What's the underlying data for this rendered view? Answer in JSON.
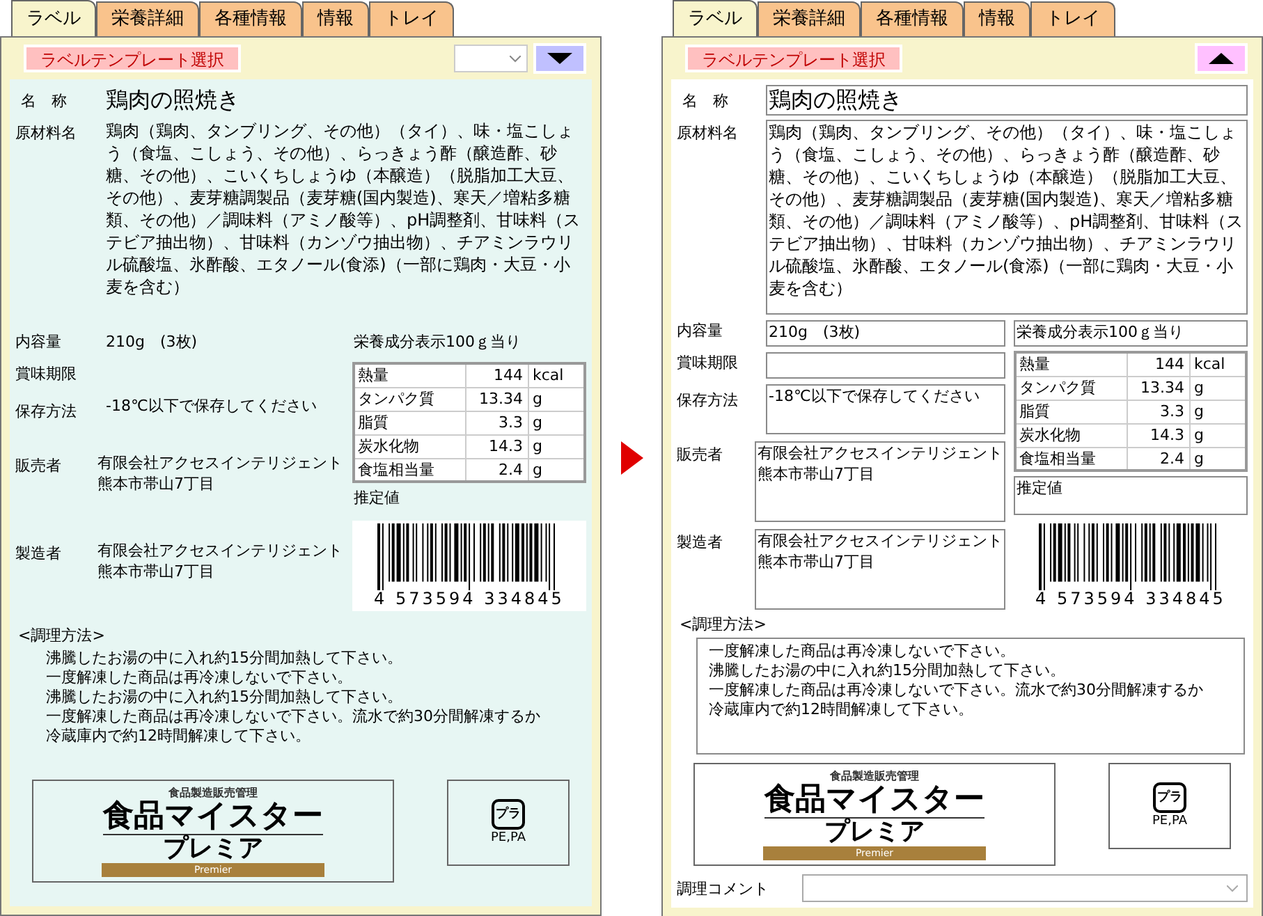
{
  "panels": [
    {
      "editable": false,
      "tabs": [
        {
          "label": "ラベル",
          "selected": true
        },
        {
          "label": "栄養詳細",
          "selected": false
        },
        {
          "label": "各種情報",
          "selected": false
        },
        {
          "label": "情報",
          "selected": false
        },
        {
          "label": "トレイ",
          "selected": false
        }
      ],
      "template_button": "ラベルテンプレート選択",
      "template_select": true,
      "expanded": false,
      "name_label": "名　称",
      "name": "鶏肉の照焼き",
      "ingredients_label": "原材料名",
      "ingredients": "鶏肉（鶏肉、タンブリング、その他）（タイ）、味・塩こしょう（食塩、こしょう、その他）、らっきょう酢（醸造酢、砂糖、その他）、こいくちしょうゆ（本醸造）（脱脂加工大豆、その他）、麦芽糖調製品（麦芽糖(国内製造)、寒天／増粘多糖類、その他）／調味料（アミノ酸等）、pH調整剤、甘味料（ステビア抽出物）、甘味料（カンゾウ抽出物）、チアミンラウリル硫酸塩、氷酢酸、エタノール(食添)（一部に鶏肉・大豆・小麦を含む）",
      "content_label": "内容量",
      "content": "210g　(3枚)",
      "best_before_label": "賞味期限",
      "storage_label": "保存方法",
      "storage": "-18℃以下で保存してください",
      "seller_label": "販売者",
      "seller": [
        "有限会社アクセスインテリジェント",
        "熊本市帯山7丁目"
      ],
      "maker_label": "製造者",
      "maker": [
        "有限会社アクセスインテリジェント",
        "熊本市帯山7丁目"
      ],
      "nutrition_title": "栄養成分表示100ｇ当り",
      "nutrition": [
        {
          "name": "熱量",
          "value": "144",
          "unit": "kcal"
        },
        {
          "name": "タンパク質",
          "value": "13.34",
          "unit": "g"
        },
        {
          "name": "脂質",
          "value": "3.3",
          "unit": "g"
        },
        {
          "name": "炭水化物",
          "value": "14.3",
          "unit": "g"
        },
        {
          "name": "食塩相当量",
          "value": "2.4",
          "unit": "g"
        }
      ],
      "nutrition_note": "推定値",
      "barcode_number": "4 573594 334845",
      "cooking_label": "<調理方法>",
      "cooking": [
        "沸騰したお湯の中に入れ約15分間加熱して下さい。",
        "一度解凍した商品は再冷凍しないで下さい。",
        "沸騰したお湯の中に入れ約15分間加熱して下さい。",
        "一度解凍した商品は再冷凍しないで下さい。流水で約30分間解凍するか",
        "冷蔵庫内で約12時間解凍して下さい。"
      ],
      "logo": {
        "caption": "食品製造販売管理",
        "title": "食品マイスター",
        "subtitle": "プレミア",
        "band": "Premier"
      },
      "recycle_label": "PE,PA",
      "recycle_mark": "プラ"
    },
    {
      "editable": true,
      "tabs": [
        {
          "label": "ラベル",
          "selected": true
        },
        {
          "label": "栄養詳細",
          "selected": false
        },
        {
          "label": "各種情報",
          "selected": false
        },
        {
          "label": "情報",
          "selected": false
        },
        {
          "label": "トレイ",
          "selected": false
        }
      ],
      "template_button": "ラベルテンプレート選択",
      "template_select": false,
      "expanded": true,
      "name_label": "名　称",
      "name": "鶏肉の照焼き",
      "ingredients_label": "原材料名",
      "ingredients": "鶏肉（鶏肉、タンブリング、その他）（タイ）、味・塩こしょう（食塩、こしょう、その他）、らっきょう酢（醸造酢、砂糖、その他）、こいくちしょうゆ（本醸造）（脱脂加工大豆、その他）、麦芽糖調製品（麦芽糖(国内製造)、寒天／増粘多糖類、その他）／調味料（アミノ酸等）、pH調整剤、甘味料（ステビア抽出物）、甘味料（カンゾウ抽出物）、チアミンラウリル硫酸塩、氷酢酸、エタノール(食添)（一部に鶏肉・大豆・小麦を含む）",
      "content_label": "内容量",
      "content": "210g　(3枚)",
      "best_before_label": "賞味期限",
      "storage_label": "保存方法",
      "storage": "-18℃以下で保存してください",
      "seller_label": "販売者",
      "seller": [
        "有限会社アクセスインテリジェント",
        "熊本市帯山7丁目"
      ],
      "maker_label": "製造者",
      "maker": [
        "有限会社アクセスインテリジェント",
        "熊本市帯山7丁目"
      ],
      "nutrition_title": "栄養成分表示100ｇ当り",
      "nutrition": [
        {
          "name": "熱量",
          "value": "144",
          "unit": "kcal"
        },
        {
          "name": "タンパク質",
          "value": "13.34",
          "unit": "g"
        },
        {
          "name": "脂質",
          "value": "3.3",
          "unit": "g"
        },
        {
          "name": "炭水化物",
          "value": "14.3",
          "unit": "g"
        },
        {
          "name": "食塩相当量",
          "value": "2.4",
          "unit": "g"
        }
      ],
      "nutrition_note": "推定値",
      "barcode_number": "4 573594 334845",
      "cooking_label": "<調理方法>",
      "cooking": [
        "一度解凍した商品は再冷凍しないで下さい。",
        "沸騰したお湯の中に入れ約15分間加熱して下さい。",
        "一度解凍した商品は再冷凍しないで下さい。流水で約30分間解凍するか",
        "冷蔵庫内で約12時間解凍して下さい。"
      ],
      "logo": {
        "caption": "食品製造販売管理",
        "title": "食品マイスター",
        "subtitle": "プレミア",
        "band": "Premier"
      },
      "recycle_label": "PE,PA",
      "recycle_mark": "プラ",
      "comment_label": "調理コメント"
    }
  ]
}
